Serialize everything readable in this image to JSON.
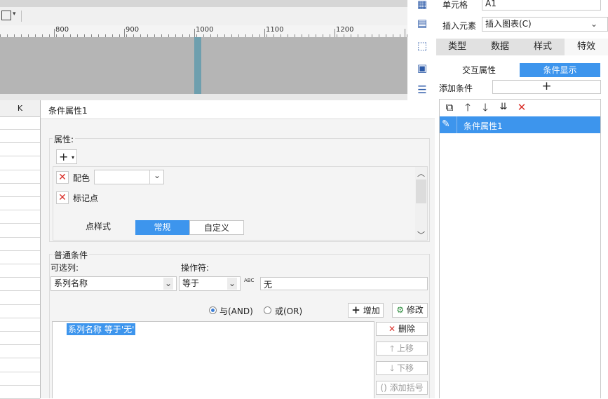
{
  "ruler": {
    "labels": [
      "800",
      "900",
      "1000",
      "1100",
      "1200"
    ]
  },
  "grid": {
    "column_header": "K"
  },
  "right_panel": {
    "cell_label": "单元格",
    "cell_value": "A1",
    "insert_label": "插入元素",
    "insert_value": "插入图表(C)",
    "tabs": [
      "类型",
      "数据",
      "样式",
      "特效"
    ],
    "subtabs": [
      "交互属性",
      "条件显示"
    ],
    "add_condition_label": "添加条件",
    "add_button": "+",
    "conditions": [
      "条件属性1"
    ]
  },
  "dialog": {
    "title": "条件属性1",
    "attributes_label": "属性:",
    "attr_color": "配色",
    "attr_marker": "标记点",
    "point_style_label": "点样式",
    "point_style_options": [
      "常规",
      "自定义"
    ],
    "general_condition_label": "普通条件",
    "optional_column_label": "可选列:",
    "operator_label": "操作符:",
    "column_value": "系列名称",
    "operator_value": "等于",
    "formula_icon_text": "ABC",
    "condition_value": "无",
    "and_label": "与(AND)",
    "or_label": "或(OR)",
    "add_label": "增加",
    "modify_label": "修改",
    "delete_label": "删除",
    "move_up_label": "上移",
    "move_down_label": "下移",
    "add_bracket_label": "添加括号",
    "expression": "系列名称 等于'无'"
  }
}
